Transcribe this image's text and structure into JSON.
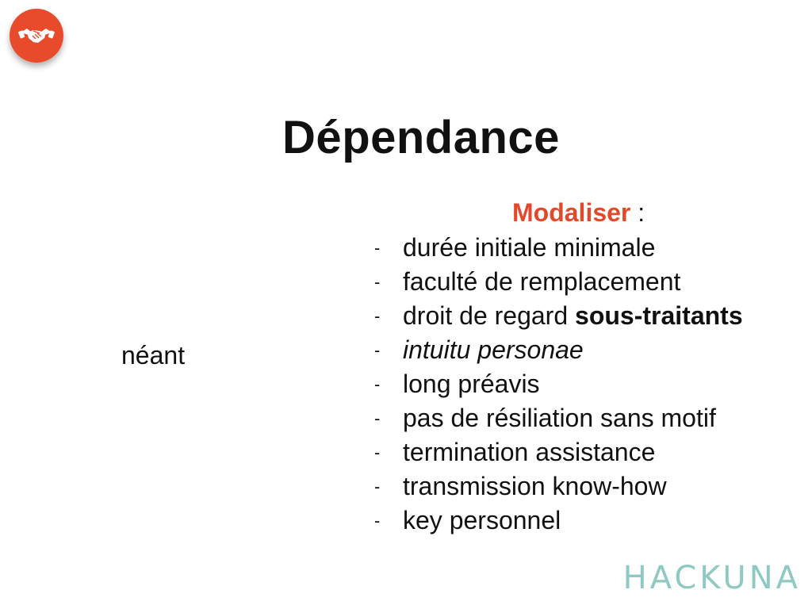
{
  "slide": {
    "title": "Dépendance",
    "left_column": {
      "text": "néant"
    },
    "right_column": {
      "heading": "Modaliser",
      "heading_suffix": " :",
      "heading_color": "#e0492a",
      "items": [
        {
          "bullet": "-",
          "text": "durée initiale minimale",
          "italic": false
        },
        {
          "bullet": "-",
          "text": "faculté de remplacement",
          "italic": false
        },
        {
          "bullet": "-",
          "text": "droit de regard ",
          "bold_text": "sous-traitants",
          "italic": false
        },
        {
          "bullet": "-",
          "text": "intuitu personae",
          "italic": true
        },
        {
          "bullet": "-",
          "text": "long préavis",
          "italic": false
        },
        {
          "bullet": "-",
          "text": "pas de résiliation sans motif",
          "italic": false
        },
        {
          "bullet": "-",
          "text": "termination assistance",
          "italic": false
        },
        {
          "bullet": "-",
          "text": "transmission know-how",
          "italic": false
        },
        {
          "bullet": "-",
          "text": "key personnel",
          "italic": false
        }
      ]
    },
    "logo": {
      "icon": "handshake-icon",
      "color": "#e84a2c"
    },
    "brand": {
      "text": "HACKUNA",
      "color": "#8fc9c2"
    }
  }
}
